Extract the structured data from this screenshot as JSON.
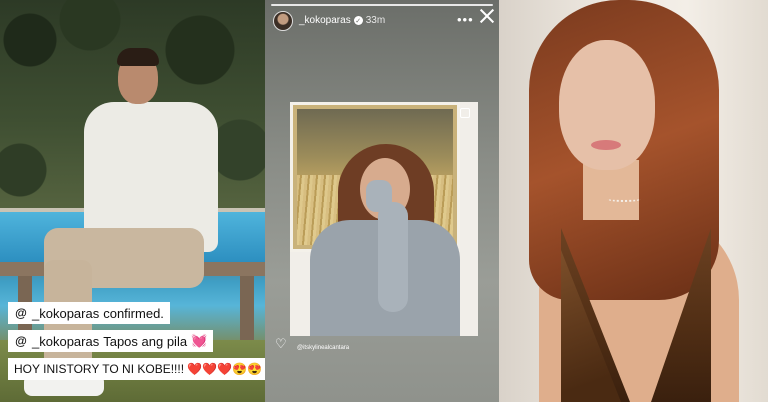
{
  "left_panel": {
    "captions": [
      {
        "handle": "_kokoparas",
        "text": "confirmed."
      },
      {
        "handle": "_kokoparas",
        "text": "Tapos ang pila",
        "emoji": "💓"
      },
      {
        "text": "HOY INISTORY TO NI KOBE!!!! ❤️❤️❤️😍😍"
      }
    ],
    "threads_icon_glyph": "@"
  },
  "story": {
    "username": "_kokoparas",
    "verified_glyph": "✓",
    "time": "33m",
    "more_glyph": "•••",
    "tagged_account": "@itskylinealcantara",
    "heart_glyph": "♡",
    "icon_names": [
      "avatar",
      "verified-icon",
      "more-icon",
      "close-icon",
      "multi-photo-icon",
      "heart-icon"
    ]
  },
  "colors": {
    "caption_bg": "#ffffff",
    "heart_accent": "#e0208a",
    "story_overlay": "#8a8d87"
  }
}
